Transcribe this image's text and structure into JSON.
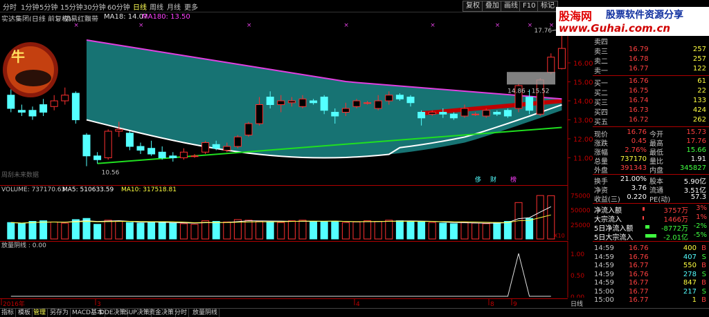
{
  "topbar": {
    "periods": [
      "分时",
      "1分钟",
      "5分钟",
      "15分钟",
      "30分钟",
      "60分钟",
      "日线",
      "周线",
      "月线",
      "更多"
    ],
    "active": "日线",
    "buttons": [
      "复权",
      "叠加",
      "画线",
      "F10",
      "标记"
    ]
  },
  "infobar": {
    "stock": "实达集团(日线 前复权)",
    "indicator": "简易红飘带",
    "ma18": "MA18: 14.07",
    "ma180": "MA180: 13.50"
  },
  "price_labels": {
    "high": "17.76",
    "low": "10.56",
    "range": "14.86 - 15.52",
    "watermark": "周刮未来数据",
    "marks": [
      "侈",
      "财",
      "榜"
    ]
  },
  "price_axis": [
    "16.00",
    "15.00",
    "14.00",
    "13.00",
    "12.00",
    "11.00"
  ],
  "volume_info": {
    "volume": "VOLUME: 737170.63",
    "ma5": "MA5: 510633.59",
    "ma10": "MA10: 317518.81",
    "axis": [
      "75000",
      "50000",
      "25000"
    ],
    "unit": "X10"
  },
  "indicator_info": {
    "title": "放量阴线 : 0.00",
    "axis": [
      "1.00",
      "0.50",
      "0.00"
    ]
  },
  "date_axis": {
    "labels": [
      "2016年",
      "3",
      "4",
      "8",
      "9"
    ],
    "right": "日线"
  },
  "bottom_tabs": [
    "指标",
    "模板",
    "管理",
    "另存为",
    "MACD基本",
    "DDE决策",
    "SUP决策",
    "资金决策",
    "分时",
    "放量阴线"
  ],
  "bottom_active": "管理",
  "logo": {
    "brand": "股海网",
    "slogan": "股票软件资源分享",
    "url": "www.Guhai.com.cn"
  },
  "order_book": {
    "asks": [
      {
        "label": "卖四",
        "price": "",
        "vol": ""
      },
      {
        "label": "卖三",
        "price": "16.79",
        "vol": "257"
      },
      {
        "label": "卖二",
        "price": "16.78",
        "vol": "257"
      },
      {
        "label": "卖一",
        "price": "16.77",
        "vol": "122"
      }
    ],
    "bids": [
      {
        "label": "买一",
        "price": "16.76",
        "vol": "61"
      },
      {
        "label": "买二",
        "price": "16.75",
        "vol": "22"
      },
      {
        "label": "买三",
        "price": "16.74",
        "vol": "133"
      },
      {
        "label": "买四",
        "price": "16.73",
        "vol": "424"
      },
      {
        "label": "买五",
        "price": "16.72",
        "vol": "262"
      }
    ]
  },
  "quote": [
    {
      "l1": "现价",
      "v1": "16.76",
      "l2": "今开",
      "v2": "15.73"
    },
    {
      "l1": "涨跌",
      "v1": "0.45",
      "l2": "最高",
      "v2": "17.76"
    },
    {
      "l1": "涨幅",
      "v1": "2.76%",
      "l2": "最低",
      "v2": "15.66"
    },
    {
      "l1": "总量",
      "v1": "737170",
      "l2": "量比",
      "v2": "1.91"
    },
    {
      "l1": "外盘",
      "v1": "391343",
      "l2": "内盘",
      "v2": "345827"
    },
    {
      "l1": "换手",
      "v1": "21.00%",
      "l2": "股本",
      "v2": "5.90亿"
    },
    {
      "l1": "净资",
      "v1": "3.76",
      "l2": "流通",
      "v2": "3.51亿"
    },
    {
      "l1": "收益(三)",
      "v1": "0.220",
      "l2": "PE(动)",
      "v2": "57.3"
    }
  ],
  "flows": [
    {
      "label": "净流入额",
      "value": "3757万",
      "pct": "3%",
      "color": "#ff4040"
    },
    {
      "label": "大宗流入",
      "value": "1466万",
      "pct": "1%",
      "color": "#ff4040"
    },
    {
      "label": "5日净流入额",
      "value": "-8772万",
      "pct": "-2%",
      "color": "#40ff40"
    },
    {
      "label": "5日大宗流入",
      "value": "-2.01亿",
      "pct": "-5%",
      "color": "#40ff40"
    }
  ],
  "ticks": [
    {
      "time": "14:59",
      "price": "16.76",
      "vol": "400",
      "side": "B"
    },
    {
      "time": "14:59",
      "price": "16.76",
      "vol": "407",
      "side": "S"
    },
    {
      "time": "14:59",
      "price": "16.77",
      "vol": "550",
      "side": "B"
    },
    {
      "time": "14:59",
      "price": "16.76",
      "vol": "278",
      "side": "S"
    },
    {
      "time": "14:59",
      "price": "16.77",
      "vol": "847",
      "side": "B"
    },
    {
      "time": "15:00",
      "price": "16.77",
      "vol": "217",
      "side": "S"
    },
    {
      "time": "15:00",
      "price": "16.77",
      "vol": "1",
      "side": "B"
    }
  ],
  "chart_data": {
    "type": "candlestick",
    "candles": [
      {
        "o": 14.3,
        "c": 13.6,
        "h": 14.6,
        "l": 13.4
      },
      {
        "o": 13.5,
        "c": 13.4,
        "h": 13.8,
        "l": 13.2
      },
      {
        "o": 13.5,
        "c": 13.2,
        "h": 13.7,
        "l": 13.0
      },
      {
        "o": 13.8,
        "c": 13.4,
        "h": 14.1,
        "l": 13.2
      },
      {
        "o": 13.7,
        "c": 14.0,
        "h": 14.3,
        "l": 13.5
      },
      {
        "o": 14.0,
        "c": 14.3,
        "h": 14.7,
        "l": 13.8
      },
      {
        "o": 14.4,
        "c": 13.0,
        "h": 14.5,
        "l": 12.8
      },
      {
        "o": 12.2,
        "c": 11.1,
        "h": 12.3,
        "l": 10.56
      },
      {
        "o": 11.1,
        "c": 10.9,
        "h": 11.3,
        "l": 10.7
      },
      {
        "o": 11.0,
        "c": 12.4,
        "h": 12.5,
        "l": 10.9
      },
      {
        "o": 12.4,
        "c": 12.5,
        "h": 12.9,
        "l": 12.1
      },
      {
        "o": 12.3,
        "c": 11.6,
        "h": 12.4,
        "l": 11.4
      },
      {
        "o": 11.6,
        "c": 11.4,
        "h": 11.8,
        "l": 11.2
      },
      {
        "o": 11.5,
        "c": 11.2,
        "h": 11.9,
        "l": 11.1
      },
      {
        "o": 11.3,
        "c": 11.0,
        "h": 11.6,
        "l": 10.9
      },
      {
        "o": 11.1,
        "c": 11.0,
        "h": 11.3,
        "l": 10.8
      },
      {
        "o": 11.0,
        "c": 11.3,
        "h": 11.5,
        "l": 10.9
      },
      {
        "o": 11.1,
        "c": 11.1,
        "h": 11.2,
        "l": 11.0
      },
      {
        "o": 11.3,
        "c": 11.8,
        "h": 11.9,
        "l": 11.2
      },
      {
        "o": 11.7,
        "c": 11.5,
        "h": 11.9,
        "l": 11.4
      },
      {
        "o": 11.4,
        "c": 11.6,
        "h": 11.8,
        "l": 11.3
      },
      {
        "o": 11.6,
        "c": 12.1,
        "h": 12.2,
        "l": 11.5
      },
      {
        "o": 12.2,
        "c": 12.8,
        "h": 12.9,
        "l": 12.1
      },
      {
        "o": 12.8,
        "c": 13.8,
        "h": 14.2,
        "l": 12.7
      },
      {
        "o": 14.2,
        "c": 13.8,
        "h": 14.5,
        "l": 13.6
      },
      {
        "o": 13.8,
        "c": 14.0,
        "h": 14.3,
        "l": 13.4
      },
      {
        "o": 13.9,
        "c": 14.0,
        "h": 14.2,
        "l": 13.7
      },
      {
        "o": 13.7,
        "c": 14.1,
        "h": 14.3,
        "l": 13.6
      },
      {
        "o": 14.0,
        "c": 13.9,
        "h": 14.1,
        "l": 13.8
      },
      {
        "o": 14.2,
        "c": 13.5,
        "h": 14.3,
        "l": 13.3
      },
      {
        "o": 13.4,
        "c": 13.2,
        "h": 13.6,
        "l": 12.8
      },
      {
        "o": 13.4,
        "c": 13.6,
        "h": 13.9,
        "l": 13.2
      },
      {
        "o": 13.7,
        "c": 14.0,
        "h": 14.1,
        "l": 13.6
      },
      {
        "o": 13.9,
        "c": 13.9,
        "h": 14.0,
        "l": 13.8
      },
      {
        "o": 13.6,
        "c": 14.0,
        "h": 14.3,
        "l": 13.5
      },
      {
        "o": 14.0,
        "c": 14.3,
        "h": 14.5,
        "l": 13.8
      },
      {
        "o": 14.3,
        "c": 14.1,
        "h": 14.4,
        "l": 14.0
      },
      {
        "o": 14.2,
        "c": 13.9,
        "h": 14.3,
        "l": 13.7
      },
      {
        "o": 13.4,
        "c": 13.1,
        "h": 13.5,
        "l": 12.7
      },
      {
        "o": 13.3,
        "c": 13.4,
        "h": 13.5,
        "l": 13.2
      },
      {
        "o": 13.4,
        "c": 13.3,
        "h": 13.6,
        "l": 13.1
      },
      {
        "o": 13.3,
        "c": 13.1,
        "h": 13.4,
        "l": 13.0
      },
      {
        "o": 13.2,
        "c": 13.6,
        "h": 13.8,
        "l": 13.1
      },
      {
        "o": 13.3,
        "c": 13.3,
        "h": 13.4,
        "l": 13.2
      },
      {
        "o": 13.2,
        "c": 13.5,
        "h": 13.6,
        "l": 13.1
      },
      {
        "o": 13.4,
        "c": 13.3,
        "h": 13.5,
        "l": 13.2
      },
      {
        "o": 13.5,
        "c": 13.2,
        "h": 13.6,
        "l": 13.1
      },
      {
        "o": 13.6,
        "c": 14.8,
        "h": 14.9,
        "l": 13.4
      },
      {
        "o": 14.2,
        "c": 13.5,
        "h": 14.6,
        "l": 13.3
      },
      {
        "o": 13.3,
        "c": 15.1,
        "h": 15.2,
        "l": 13.2
      },
      {
        "o": 15.5,
        "c": 16.3,
        "h": 16.5,
        "l": 15.4
      },
      {
        "o": 15.7,
        "c": 16.76,
        "h": 17.76,
        "l": 15.66
      }
    ],
    "volumes": [
      28000,
      26000,
      30000,
      31000,
      29000,
      27000,
      33000,
      35000,
      25000,
      32000,
      30000,
      28000,
      27000,
      28000,
      29000,
      27000,
      26000,
      25000,
      31000,
      30000,
      29000,
      33000,
      32000,
      30000,
      29000,
      28000,
      31000,
      32000,
      30000,
      29000,
      30000,
      28000,
      29000,
      31000,
      30000,
      32000,
      31000,
      30000,
      29000,
      28000,
      27000,
      26000,
      28000,
      27000,
      26000,
      28000,
      30000,
      62000,
      35000,
      74000,
      73717
    ],
    "vol_ylim": [
      0,
      80000
    ],
    "price_ylim": [
      10.0,
      18.0
    ],
    "indicator": [
      0,
      0,
      0,
      0,
      0,
      0,
      0,
      0,
      0,
      0,
      0,
      0,
      0,
      0,
      0,
      0,
      0,
      0,
      0,
      0,
      0,
      0,
      0,
      0,
      0,
      0,
      0,
      0,
      0,
      0,
      0,
      0,
      0,
      0,
      0,
      0,
      0,
      0,
      0,
      0,
      0,
      0,
      0,
      0,
      0,
      0,
      0,
      1,
      0,
      0,
      0
    ]
  }
}
